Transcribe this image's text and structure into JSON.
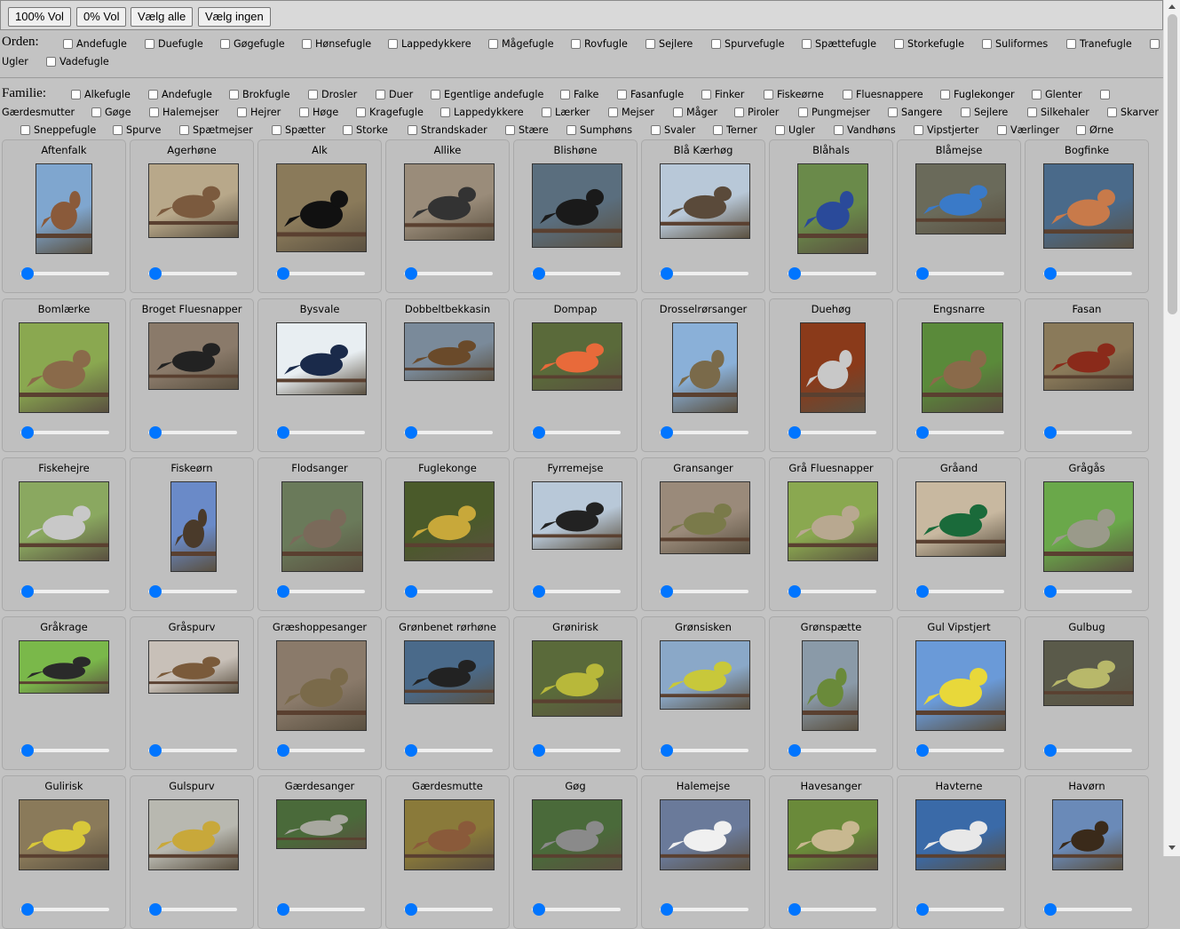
{
  "toolbar": {
    "vol100": "100% Vol",
    "vol0": "0% Vol",
    "select_all": "Vælg alle",
    "select_none": "Vælg ingen"
  },
  "orden": {
    "label": "Orden:",
    "items": [
      "Andefugle",
      "Duefugle",
      "Gøgefugle",
      "Hønsefugle",
      "Lappedykkere",
      "Mågefugle",
      "Rovfugle",
      "Sejlere",
      "Spurvefugle",
      "Spættefugle",
      "Storkefugle",
      "Suliformes",
      "Tranefugle",
      "Ugler",
      "Vadefugle"
    ]
  },
  "familie": {
    "label": "Familie:",
    "items": [
      "Alkefugle",
      "Andefugle",
      "Brokfugle",
      "Drosler",
      "Duer",
      "Egentlige andefugle",
      "Falke",
      "Fasanfugle",
      "Finker",
      "Fiskeørne",
      "Fluesnappere",
      "Fuglekonger",
      "Glenter",
      "Gærdesmutter",
      "Gøge",
      "Halemejser",
      "Hejrer",
      "Høge",
      "Kragefugle",
      "Lappedykkere",
      "Lærker",
      "Mejser",
      "Måger",
      "Piroler",
      "Pungmejser",
      "Sangere",
      "Sejlere",
      "Silkehaler",
      "Skarver",
      "Sneppefugle",
      "Spurve",
      "Spætmejser",
      "Spætter",
      "Storke",
      "Strandskader",
      "Stære",
      "Sumphøns",
      "Svaler",
      "Terner",
      "Ugler",
      "Vandhøns",
      "Vipstjerter",
      "Værlinger",
      "Ørne"
    ]
  },
  "birds": [
    {
      "name": "Aftenfalk",
      "colors": [
        "#7fa6cf",
        "#8a5a3a"
      ]
    },
    {
      "name": "Agerhøne",
      "colors": [
        "#b8a88a",
        "#7b5a3e"
      ]
    },
    {
      "name": "Alk",
      "colors": [
        "#8a7a5a",
        "#111111"
      ]
    },
    {
      "name": "Allike",
      "colors": [
        "#9a8c7a",
        "#333333"
      ]
    },
    {
      "name": "Blishøne",
      "colors": [
        "#5a6e7e",
        "#1a1a1a"
      ]
    },
    {
      "name": "Blå Kærhøg",
      "colors": [
        "#b8c8d8",
        "#5a4a3a"
      ]
    },
    {
      "name": "Blåhals",
      "colors": [
        "#6a8a4a",
        "#2a4a9a"
      ]
    },
    {
      "name": "Blåmejse",
      "colors": [
        "#6a6a5a",
        "#3a7ac8"
      ]
    },
    {
      "name": "Bogfinke",
      "colors": [
        "#4a6a8a",
        "#c87a4a"
      ]
    },
    {
      "name": "Bomlærke",
      "colors": [
        "#8aa850",
        "#8a6a4a"
      ]
    },
    {
      "name": "Broget Fluesnapper",
      "colors": [
        "#8a7a6a",
        "#222222"
      ]
    },
    {
      "name": "Bysvale",
      "colors": [
        "#e8eef2",
        "#1a2a4a"
      ]
    },
    {
      "name": "Dobbeltbekkasin",
      "colors": [
        "#7a8a9a",
        "#6a4a2a"
      ]
    },
    {
      "name": "Dompap",
      "colors": [
        "#5a6a3a",
        "#e86a3a"
      ]
    },
    {
      "name": "Drosselrørsanger",
      "colors": [
        "#8ab0d8",
        "#7a6a4a"
      ]
    },
    {
      "name": "Duehøg",
      "colors": [
        "#8a3a1a",
        "#c8c8c8"
      ]
    },
    {
      "name": "Engsnarre",
      "colors": [
        "#5a8a3a",
        "#8a6a4a"
      ]
    },
    {
      "name": "Fasan",
      "colors": [
        "#8a7a5a",
        "#8a2a1a"
      ]
    },
    {
      "name": "Fiskehejre",
      "colors": [
        "#8aa860",
        "#c8c8c8"
      ]
    },
    {
      "name": "Fiskeørn",
      "colors": [
        "#6a8ac8",
        "#4a3a2a"
      ]
    },
    {
      "name": "Flodsanger",
      "colors": [
        "#6a7a5a",
        "#7a6a5a"
      ]
    },
    {
      "name": "Fuglekonge",
      "colors": [
        "#4a5a2a",
        "#c8a83a"
      ]
    },
    {
      "name": "Fyrremejse",
      "colors": [
        "#b8c8d8",
        "#222222"
      ]
    },
    {
      "name": "Gransanger",
      "colors": [
        "#9a8a7a",
        "#7a7a4a"
      ]
    },
    {
      "name": "Grå Fluesnapper",
      "colors": [
        "#8aa850",
        "#b8a890"
      ]
    },
    {
      "name": "Gråand",
      "colors": [
        "#c8b8a0",
        "#1a6a3a"
      ]
    },
    {
      "name": "Grågås",
      "colors": [
        "#6aa84a",
        "#9a9a8a"
      ]
    },
    {
      "name": "Gråkrage",
      "colors": [
        "#7ab84a",
        "#2a2a2a"
      ]
    },
    {
      "name": "Gråspurv",
      "colors": [
        "#c8c0b8",
        "#7a5a3a"
      ]
    },
    {
      "name": "Græshoppesanger",
      "colors": [
        "#8a7a6a",
        "#7a6a4a"
      ]
    },
    {
      "name": "Grønbenet rørhøne",
      "colors": [
        "#4a6a8a",
        "#222222"
      ]
    },
    {
      "name": "Grønirisk",
      "colors": [
        "#5a6a3a",
        "#b8b83a"
      ]
    },
    {
      "name": "Grønsisken",
      "colors": [
        "#8aa8c8",
        "#c8c83a"
      ]
    },
    {
      "name": "Grønspætte",
      "colors": [
        "#8a9aa8",
        "#6a8a3a"
      ]
    },
    {
      "name": "Gul Vipstjert",
      "colors": [
        "#6a9ad8",
        "#e8d83a"
      ]
    },
    {
      "name": "Gulbug",
      "colors": [
        "#5a5a4a",
        "#b8b86a"
      ]
    },
    {
      "name": "Gulirisk",
      "colors": [
        "#8a7a5a",
        "#d8c83a"
      ]
    },
    {
      "name": "Gulspurv",
      "colors": [
        "#b8b8b0",
        "#c8a83a"
      ]
    },
    {
      "name": "Gærdesanger",
      "colors": [
        "#4a6a3a",
        "#a8a8a0"
      ]
    },
    {
      "name": "Gærdesmutte",
      "colors": [
        "#8a7a3a",
        "#8a5a3a"
      ]
    },
    {
      "name": "Gøg",
      "colors": [
        "#4a6a3a",
        "#8a8a8a"
      ]
    },
    {
      "name": "Halemejse",
      "colors": [
        "#6a7a9a",
        "#f0f0f0"
      ]
    },
    {
      "name": "Havesanger",
      "colors": [
        "#6a8a3a",
        "#c8b890"
      ]
    },
    {
      "name": "Havterne",
      "colors": [
        "#3a6aa8",
        "#e8e8e8"
      ]
    },
    {
      "name": "Havørn",
      "colors": [
        "#6a8ab8",
        "#3a2a1a"
      ]
    }
  ]
}
